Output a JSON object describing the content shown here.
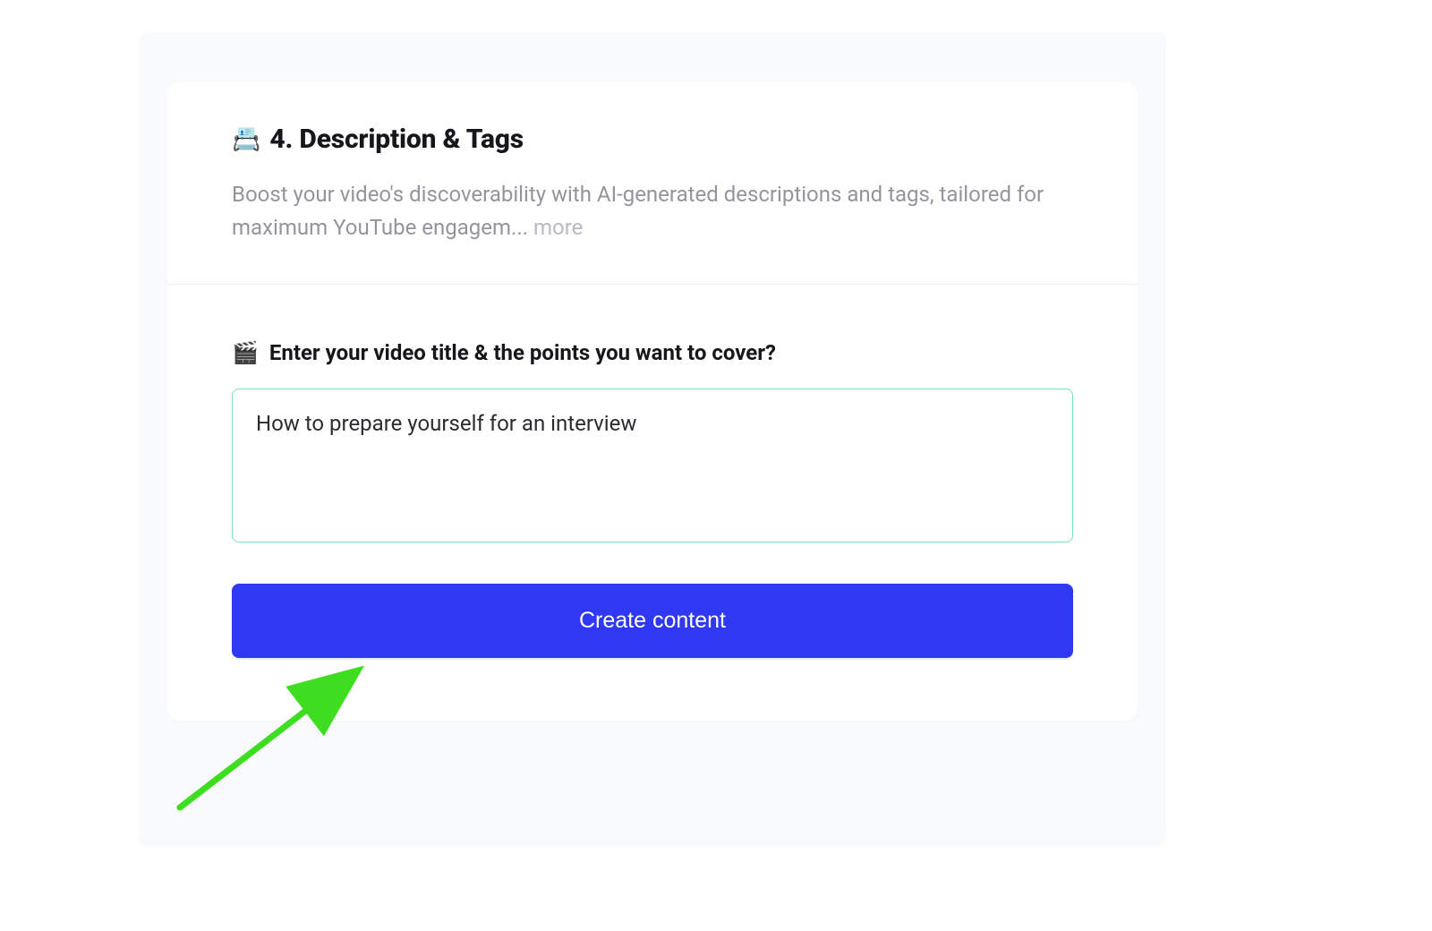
{
  "section": {
    "icon": "📇",
    "title": "4. Description & Tags",
    "subtitle": "Boost your video's discoverability with AI-generated descriptions and tags, tailored for maximum YouTube engagem...",
    "more_label": "more"
  },
  "form": {
    "prompt_icon": "🎬",
    "prompt_label": "Enter your video title & the points you want to cover?",
    "input_value": "How to prepare yourself for an interview",
    "submit_label": "Create content"
  },
  "colors": {
    "accent": "#2f39f3",
    "input_border": "#7fdcc4",
    "annotation": "#3cde1f"
  }
}
